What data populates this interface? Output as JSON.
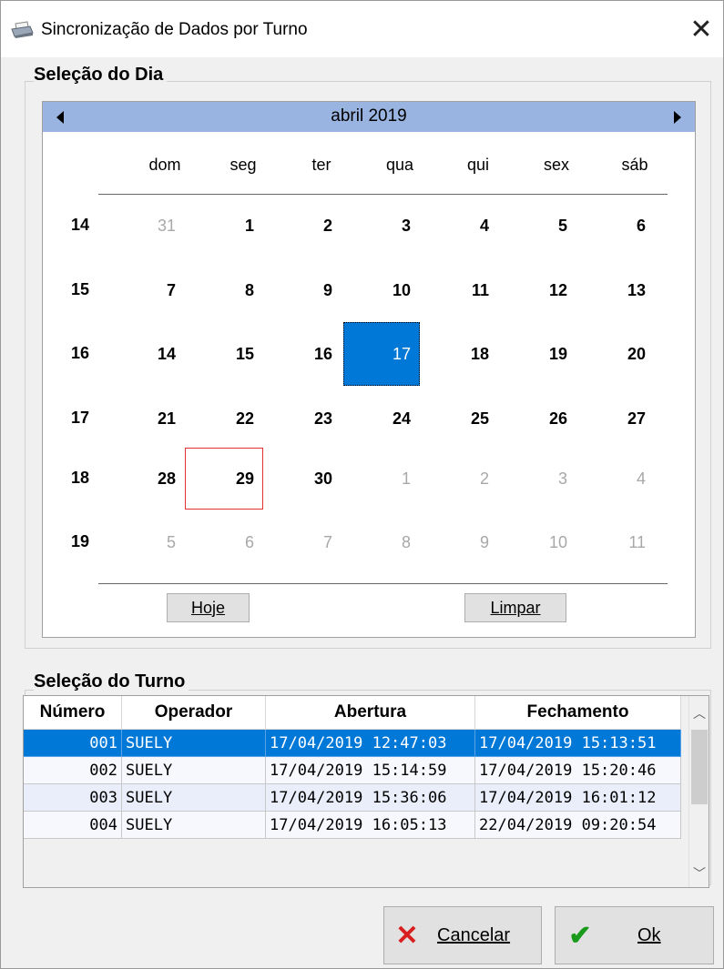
{
  "window": {
    "title": "Sincronização de Dados por Turno"
  },
  "day_group": {
    "title": "Seleção do Dia"
  },
  "calendar": {
    "month_label": "abril 2019",
    "weekdays": [
      "dom",
      "seg",
      "ter",
      "qua",
      "qui",
      "sex",
      "sáb"
    ],
    "week_numbers": [
      "14",
      "15",
      "16",
      "17",
      "18",
      "19"
    ],
    "weeks": [
      [
        {
          "d": "31",
          "muted": true
        },
        {
          "d": "1"
        },
        {
          "d": "2"
        },
        {
          "d": "3"
        },
        {
          "d": "4"
        },
        {
          "d": "5"
        },
        {
          "d": "6"
        }
      ],
      [
        {
          "d": "7"
        },
        {
          "d": "8"
        },
        {
          "d": "9"
        },
        {
          "d": "10"
        },
        {
          "d": "11"
        },
        {
          "d": "12"
        },
        {
          "d": "13"
        }
      ],
      [
        {
          "d": "14"
        },
        {
          "d": "15"
        },
        {
          "d": "16"
        },
        {
          "d": "17",
          "selected": true
        },
        {
          "d": "18"
        },
        {
          "d": "19"
        },
        {
          "d": "20"
        }
      ],
      [
        {
          "d": "21"
        },
        {
          "d": "22"
        },
        {
          "d": "23"
        },
        {
          "d": "24"
        },
        {
          "d": "25"
        },
        {
          "d": "26"
        },
        {
          "d": "27"
        }
      ],
      [
        {
          "d": "28"
        },
        {
          "d": "29",
          "today": true
        },
        {
          "d": "30"
        },
        {
          "d": "1",
          "muted": true
        },
        {
          "d": "2",
          "muted": true
        },
        {
          "d": "3",
          "muted": true
        },
        {
          "d": "4",
          "muted": true
        }
      ],
      [
        {
          "d": "5",
          "muted": true
        },
        {
          "d": "6",
          "muted": true
        },
        {
          "d": "7",
          "muted": true
        },
        {
          "d": "8",
          "muted": true
        },
        {
          "d": "9",
          "muted": true
        },
        {
          "d": "10",
          "muted": true
        },
        {
          "d": "11",
          "muted": true
        }
      ]
    ],
    "today_button": "Hoje",
    "clear_button": "Limpar"
  },
  "shift_group": {
    "title": "Seleção do Turno"
  },
  "shift_table": {
    "columns": [
      "Número",
      "Operador",
      "Abertura",
      "Fechamento"
    ],
    "rows": [
      [
        "001",
        "SUELY",
        "17/04/2019 12:47:03",
        "17/04/2019 15:13:51"
      ],
      [
        "002",
        "SUELY",
        "17/04/2019 15:14:59",
        "17/04/2019 15:20:46"
      ],
      [
        "003",
        "SUELY",
        "17/04/2019 15:36:06",
        "17/04/2019 16:01:12"
      ],
      [
        "004",
        "SUELY",
        "17/04/2019 16:05:13",
        "22/04/2019 09:20:54"
      ]
    ],
    "selected_row": 0
  },
  "actions": {
    "cancel_label": "Cancelar",
    "ok_label": "Ok"
  },
  "icons": {
    "window": "printer-icon",
    "close": "close-icon",
    "cancel": "x-icon",
    "ok": "check-icon"
  },
  "colors": {
    "selection": "#0078d7",
    "calendar_header": "#99b4e0",
    "today_marker": "#e03030",
    "cancel_icon": "#d81e1e",
    "ok_icon": "#1a9a1a"
  }
}
